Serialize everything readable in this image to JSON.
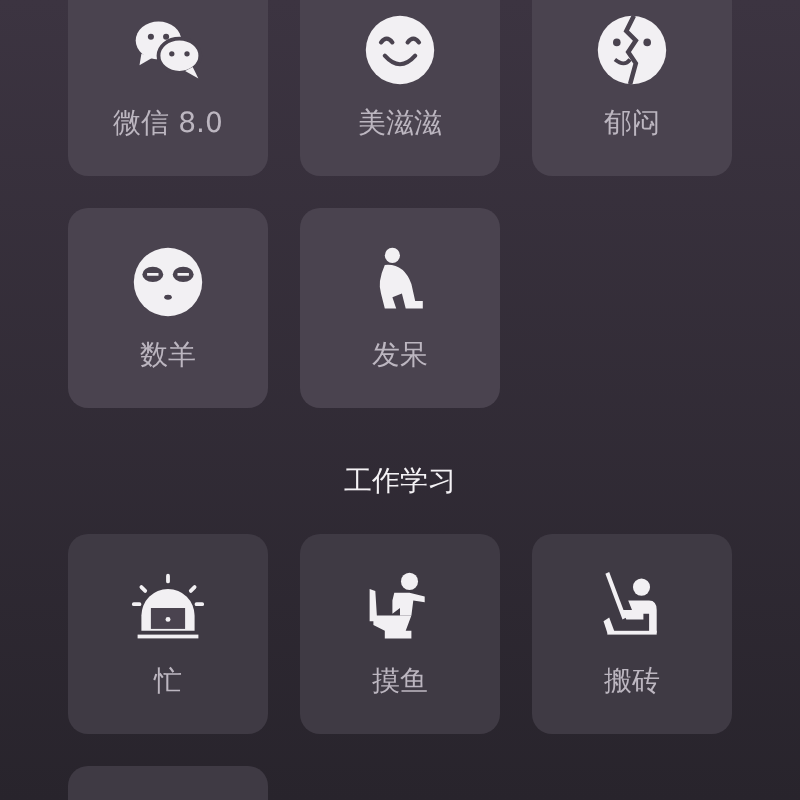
{
  "sections": [
    {
      "items": [
        {
          "kind": "chat",
          "label": "微信 8.0"
        },
        {
          "kind": "smile",
          "label": "美滋滋"
        },
        {
          "kind": "cracked",
          "label": "郁闷"
        },
        {
          "kind": "sleepy",
          "label": "数羊"
        },
        {
          "kind": "squat",
          "label": "发呆"
        }
      ]
    },
    {
      "title": "工作学习",
      "items": [
        {
          "kind": "alarm",
          "label": "忙"
        },
        {
          "kind": "toilet",
          "label": "摸鱼"
        },
        {
          "kind": "worker",
          "label": "搬砖"
        },
        {
          "kind": "blank"
        }
      ]
    }
  ]
}
